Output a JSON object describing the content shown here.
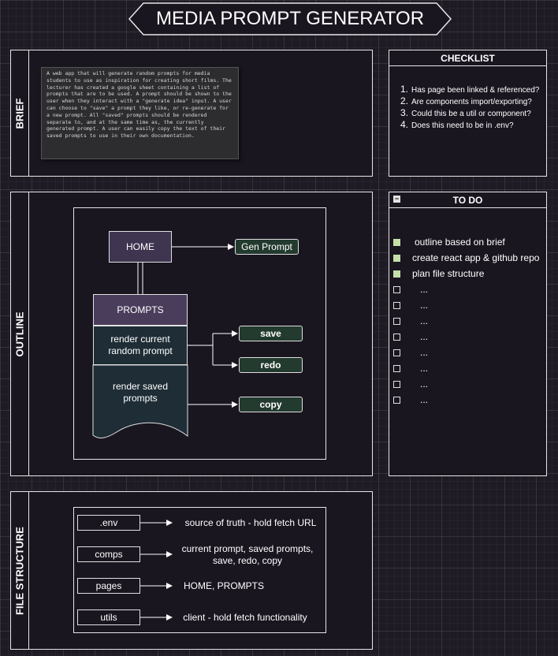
{
  "title": "MEDIA PROMPT GENERATOR",
  "brief": {
    "label": "BRIEF",
    "text": "A web app that will generate random prompts for media students to use as inspiration for creating short films. The lecturer has created a google sheet containing a list of prompts that are to be used. A prompt should be shown to the user when they interact with a \"generate idea\" input. A user can choose to \"save\" a prompt they like, or re-generate for a new prompt. All \"saved\" prompts should be rendered separate to, and at the same time as, the currently generated prompt. A user can easily copy the text of their saved prompts to use in their own documentation."
  },
  "checklist": {
    "title": "CHECKLIST",
    "items": [
      {
        "num": "1.",
        "text": "Has page been linked & referenced?"
      },
      {
        "num": "2.",
        "text": "Are components import/exporting?"
      },
      {
        "num": "3.",
        "text": "Could this be a util or component?"
      },
      {
        "num": "4.",
        "text": "Does this need to be in .env?"
      }
    ]
  },
  "todo": {
    "title": "TO DO",
    "collapse_symbol": "−",
    "items": [
      {
        "text": "outline based on brief",
        "checked": true
      },
      {
        "text": "create react app & github repo",
        "checked": true
      },
      {
        "text": "plan file structure",
        "checked": true
      },
      {
        "text": "...",
        "checked": false
      },
      {
        "text": "...",
        "checked": false
      },
      {
        "text": "...",
        "checked": false
      },
      {
        "text": "...",
        "checked": false
      },
      {
        "text": "...",
        "checked": false
      },
      {
        "text": "...",
        "checked": false
      },
      {
        "text": "...",
        "checked": false
      },
      {
        "text": "...",
        "checked": false
      }
    ]
  },
  "outline": {
    "label": "OUTLINE",
    "home": "HOME",
    "gen_prompt": "Gen Prompt",
    "prompts": "PROMPTS",
    "render_current": "render current random prompt",
    "render_saved": "render saved prompts",
    "save": "save",
    "redo": "redo",
    "copy": "copy"
  },
  "file_structure": {
    "label": "FILE STRUCTURE",
    "rows": [
      {
        "name": ".env",
        "desc": "source of truth - hold fetch URL"
      },
      {
        "name": "comps",
        "desc": "current prompt, saved prompts, save, redo, copy"
      },
      {
        "name": "pages",
        "desc": "HOME, PROMPTS"
      },
      {
        "name": "utils",
        "desc": "client - hold fetch functionality"
      }
    ]
  },
  "colors": {
    "pill_green": "#233a2f",
    "prompts_header": "#4a3d5c",
    "home_box": "#3f3550",
    "render_box": "#1e2d36",
    "checked": "#c4e0a8"
  }
}
